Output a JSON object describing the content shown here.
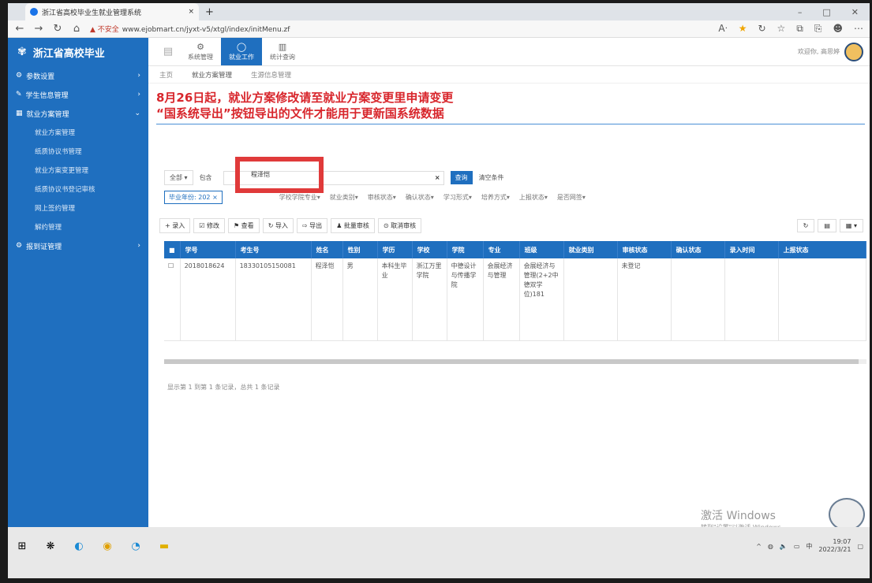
{
  "browser": {
    "tab_title": "浙江省高校毕业生就业管理系统",
    "tab_close": "×",
    "new_tab": "+",
    "not_secure": "▲ 不安全",
    "url": "www.ejobmart.cn/jyxt-v5/xtgl/index/initMenu.zf"
  },
  "app": {
    "brand": "浙江省高校毕业",
    "welcome": "欢迎你, 高思婷",
    "top_menu": [
      {
        "label": "系统管理",
        "icon": "gear-icon"
      },
      {
        "label": "就业工作",
        "icon": "chat-icon"
      },
      {
        "label": "统计查询",
        "icon": "chart-icon"
      }
    ]
  },
  "sidebar": {
    "items": [
      {
        "label": "参数设置",
        "arrow": "›"
      },
      {
        "label": "学生信息管理",
        "arrow": "›"
      },
      {
        "label": "就业方案管理",
        "arrow": "⌄"
      }
    ],
    "subitems": [
      "就业方案管理",
      "纸质协议书管理",
      "就业方案变更管理",
      "纸质协议书登记审核",
      "网上签约管理",
      "解约管理"
    ],
    "last_item": {
      "label": "报到证管理",
      "arrow": "›"
    }
  },
  "breadcrumbs": [
    "主页",
    "就业方案管理",
    "生源信息管理"
  ],
  "notice": {
    "line1": "8月26日起，就业方案修改请至就业方案变更里申请变更",
    "line2": "“国系统导出”按钮导出的文件才能用于更新国系统数据"
  },
  "filter": {
    "scope": "全部 ▾",
    "match": "包含",
    "search_value": "程泽恺",
    "clear_x": "×",
    "query": "查询",
    "clear": "清空条件",
    "year_label": "毕业年份: 202",
    "year_x": "×",
    "dropdowns": [
      "学校学院专业▾",
      "就业类别▾",
      "审核状态▾",
      "确认状态▾",
      "学习形式▾",
      "培养方式▾",
      "上报状态▾",
      "是否网签▾"
    ]
  },
  "toolbar": {
    "buttons": [
      "+ 录入",
      "☑ 修改",
      "⚑ 查看",
      "↻ 导入",
      "⇨ 导出",
      "♟ 批量审核",
      "⊙ 取消审核"
    ],
    "right": [
      "↻",
      "▤",
      "▦ ▾"
    ]
  },
  "table": {
    "headers": [
      "学号",
      "考生号",
      "姓名",
      "性别",
      "学历",
      "学校",
      "学院",
      "专业",
      "班级",
      "就业类别",
      "审核状态",
      "确认状态",
      "录入时间",
      "上报状态"
    ],
    "rows": [
      [
        "2018018624",
        "18330105150081",
        "程泽恺",
        "男",
        "本科生毕业",
        "浙江万里学院",
        "中德设计与传播学院",
        "会展经济与管理",
        "会展经济与管理(2+2中德双学位)181",
        "",
        "未登记",
        "",
        "",
        ""
      ]
    ]
  },
  "pager": "显示第 1 到第 1 条记录，总共 1 条记录",
  "watermark": {
    "title": "激活 Windows",
    "sub": "转到\"设置\"以激活 Windows。"
  },
  "taskbar": {
    "time": "19:07",
    "date": "2022/3/21"
  }
}
